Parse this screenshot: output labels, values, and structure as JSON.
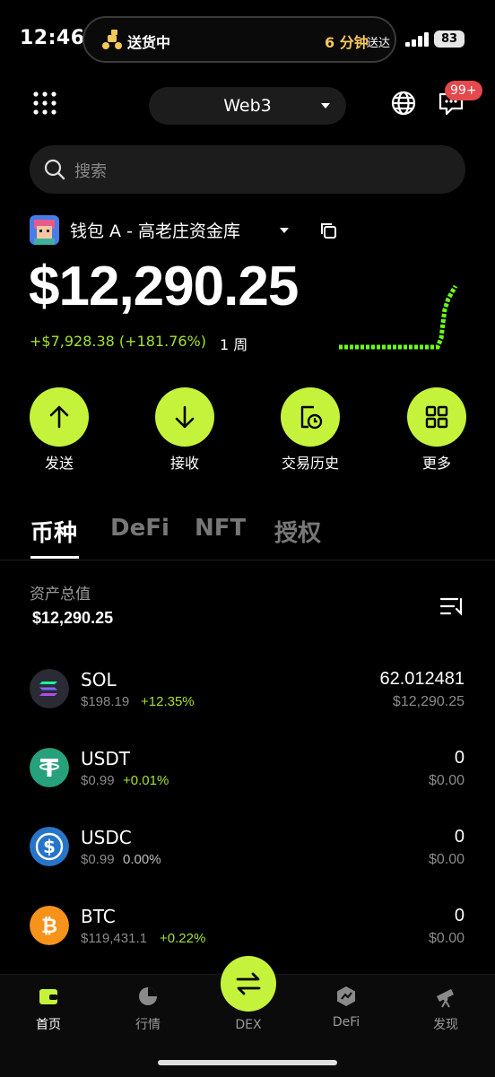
{
  "status_bar": {
    "time": "12:46",
    "live_activity": {
      "label": "送货中",
      "eta": "6 分钟",
      "eta_suffix": "送达"
    },
    "battery": "83"
  },
  "header": {
    "network_selector": "Web3",
    "notification_badge": "99+"
  },
  "search": {
    "placeholder": "搜索"
  },
  "wallet": {
    "name": "钱包 A - 高老庄资金库",
    "balance": "$12,290.25",
    "change": "+$7,928.38 (+181.76%)",
    "period": "1 周"
  },
  "actions": [
    {
      "label": "发送",
      "icon": "arrow-up-icon"
    },
    {
      "label": "接收",
      "icon": "arrow-down-icon"
    },
    {
      "label": "交易历史",
      "icon": "history-icon"
    },
    {
      "label": "更多",
      "icon": "grid-icon"
    }
  ],
  "tabs": [
    "币种",
    "DeFi",
    "NFT",
    "授权"
  ],
  "assets": {
    "total_label": "资产总值",
    "total_value": "$12,290.25",
    "tokens": [
      {
        "symbol": "SOL",
        "price": "$198.19",
        "change": "+12.35%",
        "change_color": "#a6e22e",
        "amount": "62.012481",
        "value": "$12,290.25"
      },
      {
        "symbol": "USDT",
        "price": "$0.99",
        "change": "+0.01%",
        "change_color": "#a6e22e",
        "amount": "0",
        "value": "$0.00"
      },
      {
        "symbol": "USDC",
        "price": "$0.99",
        "change": "0.00%",
        "change_color": "#bbbbbb",
        "amount": "0",
        "value": "$0.00"
      },
      {
        "symbol": "BTC",
        "price": "$119,431.1",
        "change": "+0.22%",
        "change_color": "#a6e22e",
        "amount": "0",
        "value": "$0.00"
      }
    ]
  },
  "bottom_nav": [
    {
      "label": "首页",
      "icon": "wallet-icon"
    },
    {
      "label": "行情",
      "icon": "market-icon"
    },
    {
      "label": "DEX",
      "icon": "swap-icon"
    },
    {
      "label": "DeFi",
      "icon": "defi-icon"
    },
    {
      "label": "发现",
      "icon": "telescope-icon"
    }
  ],
  "colors": {
    "accent": "#c5f33b",
    "positive": "#a6e22e",
    "badge": "#e5484d",
    "background": "#000000"
  }
}
